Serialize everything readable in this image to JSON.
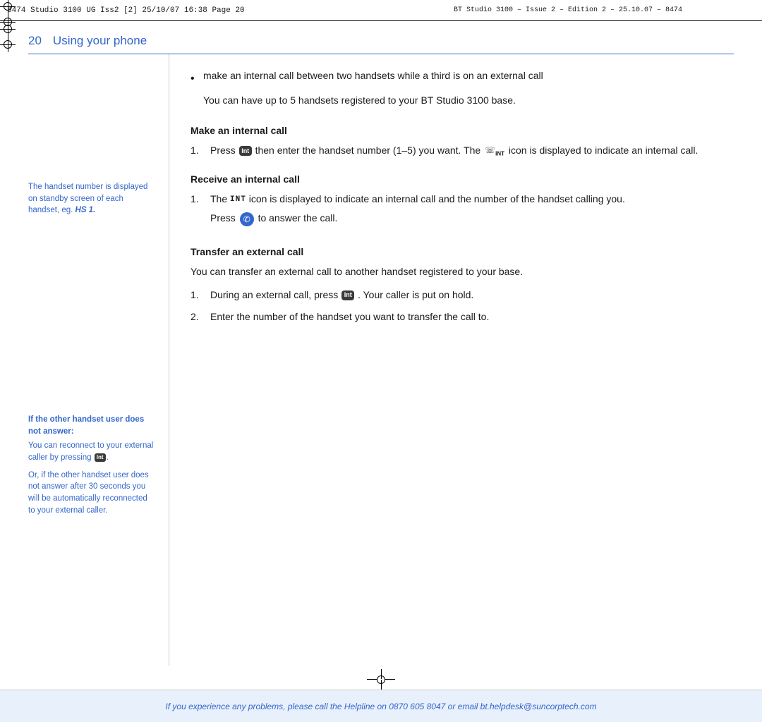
{
  "header": {
    "left_text": "8474 Studio 3100 UG Iss2 [2]   25/10/07  16:38  Page 20",
    "right_text": "BT Studio 3100 – Issue 2 – Edition 2 – 25.10.07 – 8474"
  },
  "page": {
    "number": "20",
    "title": "Using your phone"
  },
  "sidebar": {
    "note": "The handset number is displayed on standby screen of each handset, eg.",
    "note_example": "HS 1.",
    "warning_title": "If the other handset user does not answer:",
    "warning_body1": "You can reconnect to your external caller by pressing",
    "warning_btn": "Int",
    "warning_body2": "Or, if the other handset user does not answer after 30 seconds you will be automatically reconnected to your external caller."
  },
  "content": {
    "bullet1": "make an internal call between two handsets while a third is on an external call",
    "bullet1_sub": "You can have up to 5 handsets registered to your BT Studio 3100 base.",
    "section1_heading": "Make an internal call",
    "step1_1_pre": "Press",
    "step1_1_btn": "Int",
    "step1_1_text": "then enter the handset number (1–5) you want. The",
    "step1_1_icon_desc": "phone-int",
    "step1_1_suffix": "icon is displayed to indicate an internal call.",
    "section2_heading": "Receive an internal call",
    "step2_1_pre": "The",
    "step2_1_int": "INT",
    "step2_1_text": "icon is displayed to indicate an internal call and the number of the handset calling you.",
    "step2_1_sub_pre": "Press",
    "step2_1_sub_text": "to answer the call.",
    "section3_heading": "Transfer an external call",
    "section3_intro": "You can transfer an external call to another handset registered to your base.",
    "step3_1_pre": "During an external call, press",
    "step3_1_btn": "Int",
    "step3_1_text": ". Your caller is put on hold.",
    "step3_2_text": "Enter the number of the handset you want to transfer the call to.",
    "footer_text": "If you experience any problems, please call the Helpline on 0870 605 8047 or email bt.helpdesk@suncorptech.com"
  }
}
